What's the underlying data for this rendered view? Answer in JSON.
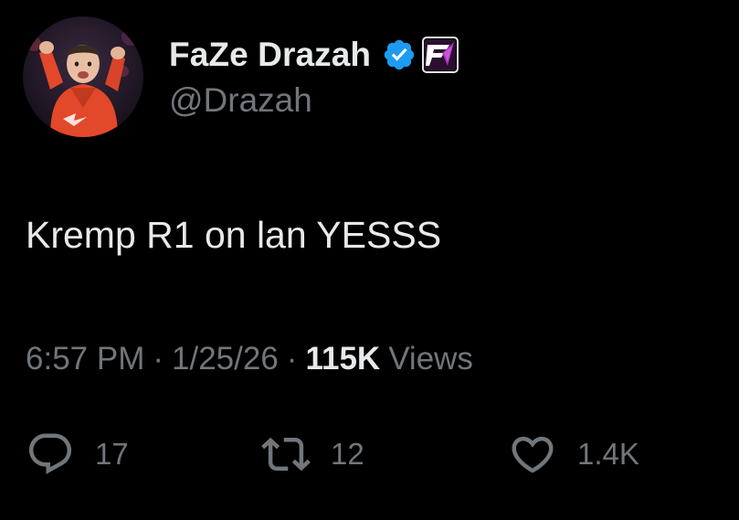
{
  "author": {
    "display_name": "FaZe Drazah",
    "handle": "@Drazah",
    "verified_icon": "verified-badge-icon",
    "affiliate_icon": "affiliate-badge-icon"
  },
  "tweet": {
    "text": "Kremp R1 on lan YESSS"
  },
  "meta": {
    "time": "6:57 PM",
    "separator": "·",
    "date": "1/25/26",
    "views_count": "115K",
    "views_label": "Views"
  },
  "actions": {
    "reply": {
      "icon": "reply-icon",
      "count": "17"
    },
    "retweet": {
      "icon": "retweet-icon",
      "count": "12"
    },
    "like": {
      "icon": "heart-icon",
      "count": "1.4K"
    }
  },
  "colors": {
    "background": "#000000",
    "primary_text": "#e7e9ea",
    "secondary_text": "#71767b",
    "verified_blue": "#1d9bf0",
    "avatar_jacket": "#e2482a"
  }
}
